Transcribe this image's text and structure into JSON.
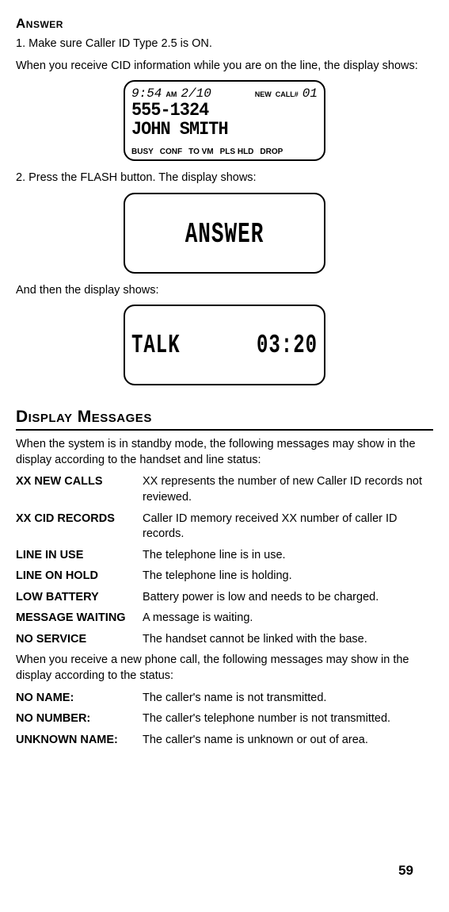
{
  "sections": {
    "answer": {
      "heading": "Answer",
      "step1": "1.  Make sure Caller ID Type 2.5 is ON.",
      "p1": "When you receive CID information while you are on the line, the display shows:",
      "step2": "2. Press the FLASH button. The display shows:",
      "p2": "And then the display shows:"
    },
    "display_messages": {
      "heading": "Display Messages",
      "intro1": "When the system is in standby mode, the following messages may show in the display according to the handset and line status:",
      "intro2": "When you receive a new phone call, the following messages may show in the display according to the status:"
    }
  },
  "lcd1": {
    "time": "9:54",
    "ampm": "AM",
    "date": "2/10",
    "new_label": "NEW",
    "call_label": "CALL#",
    "call_num": "01",
    "phone": "555-1324",
    "name": "JOHN SMITH",
    "b1": "BUSY",
    "b2": "CONF",
    "b3": "TO VM",
    "b4": "PLS HLD",
    "b5": "DROP"
  },
  "lcd2": {
    "text": "ANSWER"
  },
  "lcd3": {
    "left": "TALK",
    "right": "03:20"
  },
  "msgs_standby": [
    {
      "term": "XX NEW CALLS",
      "desc": "XX represents the number of new Caller ID records not reviewed."
    },
    {
      "term": "XX CID RECORDS",
      "desc": "Caller ID memory received XX number of caller ID records."
    },
    {
      "term": "LINE IN USE",
      "desc": "The telephone line is in use."
    },
    {
      "term": "LINE ON HOLD",
      "desc": "The telephone line is holding."
    },
    {
      "term": "LOW BATTERY",
      "desc": "Battery power is low and needs to be charged."
    },
    {
      "term": "MESSAGE WAITING",
      "desc": "A message is waiting."
    },
    {
      "term": "NO SERVICE",
      "desc": "The handset cannot be linked with the base."
    }
  ],
  "msgs_call": [
    {
      "term": "NO NAME:",
      "desc": "The caller's name is not transmitted."
    },
    {
      "term": "NO NUMBER:",
      "desc": "The caller's telephone number is not transmitted."
    },
    {
      "term": "UNKNOWN NAME:",
      "desc": "The caller's name is unknown or out of area."
    }
  ],
  "page": "59"
}
